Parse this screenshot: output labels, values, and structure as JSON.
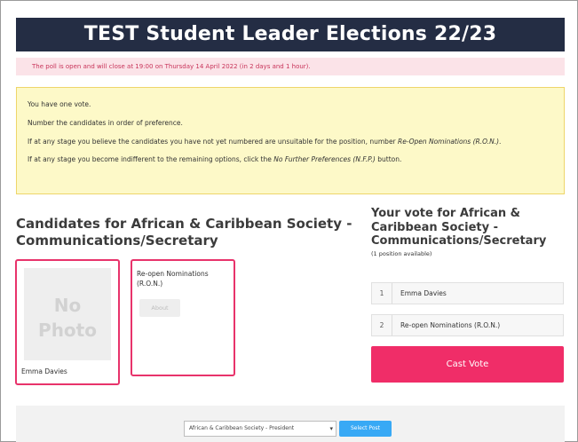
{
  "header": {
    "title": "TEST Student Leader Elections 22/23"
  },
  "notice": {
    "text": "The poll is open and will close at 19:00 on Thursday 14 April 2022 (in 2 days and 1 hour)."
  },
  "instructions": {
    "line1": "You have one vote.",
    "line2": "Number the candidates in order of preference.",
    "line3_prefix": "If at any stage you believe the candidates you have not yet numbered are unsuitable for the position, number ",
    "line3_emphasis": "Re-Open Nominations (R.O.N.)",
    "line3_suffix": ".",
    "line4_prefix": "If at any stage you become indifferent to the remaining options, click the ",
    "line4_emphasis": "No Further Preferences (N.F.P.)",
    "line4_suffix": " button."
  },
  "candidates": {
    "heading": "Candidates for African & Caribbean Society - Communications/Secretary",
    "photo_placeholder_line1": "No",
    "photo_placeholder_line2": "Photo",
    "candidate_name": "Emma Davies",
    "ron_label": "Re-open Nominations (R.O.N.)",
    "about_label": "About"
  },
  "vote_panel": {
    "heading": "Your vote for African & Caribbean Society - Communications/Secretary",
    "positions_note": "(1 position available)",
    "preferences": [
      {
        "rank": "1",
        "name": "Emma Davies"
      },
      {
        "rank": "2",
        "name": "Re-open Nominations (R.O.N.)"
      }
    ],
    "cast_vote_label": "Cast Vote"
  },
  "footer": {
    "role_select_value": "African & Caribbean Society - President",
    "select_button_label": "Select Post"
  },
  "colors": {
    "title_bg": "#242d44",
    "accent_pink": "#f02d68",
    "notice_bg": "#fbe3e8",
    "instructions_bg": "#fdf9c8",
    "select_button": "#38a9f5"
  }
}
